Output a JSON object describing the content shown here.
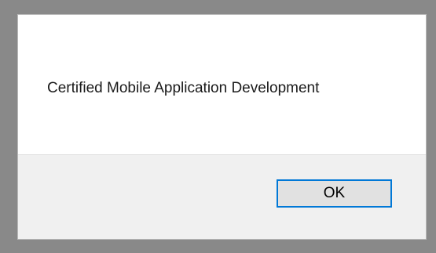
{
  "dialog": {
    "message": "Certified Mobile Application Development",
    "ok_label": "OK"
  },
  "colors": {
    "backdrop": "#898989",
    "content_bg": "#ffffff",
    "footer_bg": "#f0f0f0",
    "button_bg": "#e1e1e1",
    "button_focus_border": "#0078d7"
  }
}
